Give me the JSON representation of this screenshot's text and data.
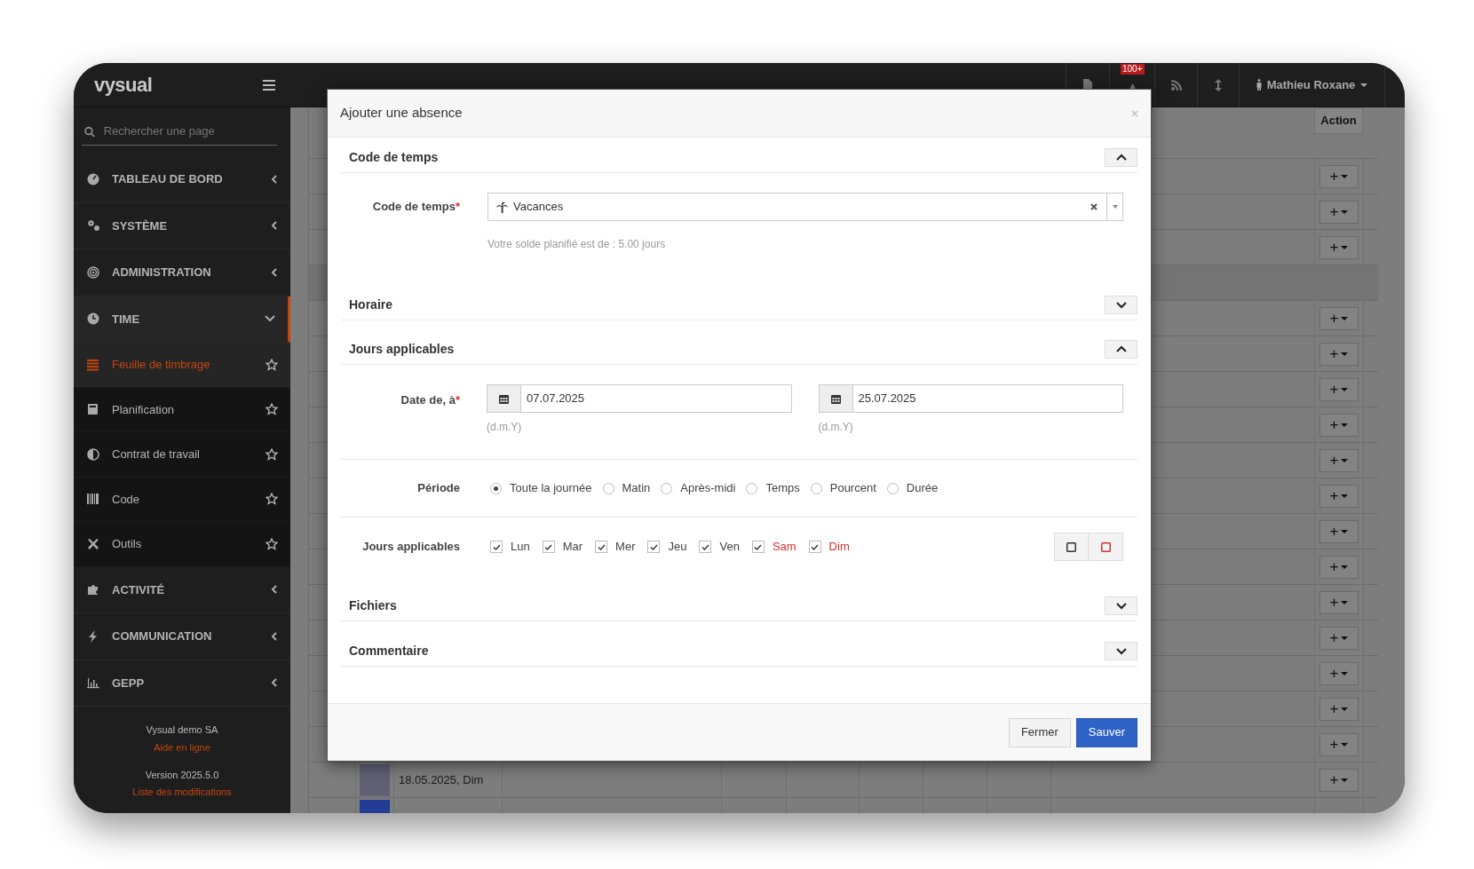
{
  "header": {
    "logo": "vysual",
    "notification_badge": "100+",
    "user": "Mathieu Roxane"
  },
  "sidebar": {
    "search_placeholder": "Rechercher une page",
    "items": [
      {
        "label": "TABLEAU DE BORD",
        "kind": "section",
        "expanded": false
      },
      {
        "label": "SYSTÈME",
        "kind": "section",
        "expanded": false
      },
      {
        "label": "ADMINISTRATION",
        "kind": "section",
        "expanded": false
      },
      {
        "label": "TIME",
        "kind": "section",
        "expanded": true
      },
      {
        "label": "Feuille de timbrage",
        "kind": "page",
        "selected": true
      },
      {
        "label": "Planification",
        "kind": "page",
        "selected": false
      },
      {
        "label": "Contrat de travail",
        "kind": "page",
        "selected": false
      },
      {
        "label": "Code",
        "kind": "page",
        "selected": false
      },
      {
        "label": "Outils",
        "kind": "page",
        "selected": false
      },
      {
        "label": "ACTIVITÉ",
        "kind": "section",
        "expanded": false
      },
      {
        "label": "COMMUNICATION",
        "kind": "section",
        "expanded": false
      },
      {
        "label": "GEPP",
        "kind": "section",
        "expanded": false
      }
    ],
    "footer": {
      "company": "Vysual demo SA",
      "help_link": "Aide en ligne",
      "version": "Version 2025.5.0",
      "changelog_link": "Liste des modifications"
    }
  },
  "table": {
    "action_header": "Action",
    "rows": [
      {
        "kind": "row",
        "action": "+"
      },
      {
        "kind": "row",
        "action": "+"
      },
      {
        "kind": "row",
        "action": "+"
      },
      {
        "kind": "group"
      },
      {
        "kind": "row",
        "action": "+"
      },
      {
        "kind": "row",
        "action": "+"
      },
      {
        "kind": "row",
        "action": "+"
      },
      {
        "kind": "row",
        "action": "+"
      },
      {
        "kind": "row",
        "action": "+"
      },
      {
        "kind": "row",
        "action": "+"
      },
      {
        "kind": "row",
        "action": "+"
      },
      {
        "kind": "row",
        "action": "+"
      },
      {
        "kind": "row",
        "action": "+"
      },
      {
        "kind": "row",
        "action": "+"
      },
      {
        "kind": "row",
        "action": "+"
      },
      {
        "kind": "row",
        "action": "+"
      },
      {
        "kind": "row",
        "action": "+"
      },
      {
        "kind": "row",
        "action": "+",
        "color": "#5f6074",
        "date": "18.05.2025, Dim"
      },
      {
        "kind": "row",
        "color": "#233c96"
      }
    ]
  },
  "modal": {
    "title": "Ajouter une absence",
    "time_code_section": {
      "title": "Code de temps",
      "expanded": true,
      "label": "Code de temps",
      "required_mark": "*",
      "value": "Vacances",
      "hint": "Votre solde planifié est de : 5.00 jours"
    },
    "schedule_section": {
      "title": "Horaire",
      "expanded": false
    },
    "days_section": {
      "title": "Jours applicables",
      "expanded": true,
      "date_label": "Date de, à",
      "required_mark": "*",
      "date_from": "07.07.2025",
      "date_to": "25.07.2025",
      "format_from": "(d.m.Y)",
      "format_to": "(d.m.Y)",
      "period_label": "Période",
      "periods": [
        {
          "label": "Toute la journée",
          "selected": true
        },
        {
          "label": "Matin",
          "selected": false
        },
        {
          "label": "Après-midi",
          "selected": false
        },
        {
          "label": "Temps",
          "selected": false
        },
        {
          "label": "Pourcent",
          "selected": false
        },
        {
          "label": "Durée",
          "selected": false
        }
      ],
      "days_label": "Jours applicables",
      "days": [
        {
          "label": "Lun",
          "checked": true,
          "weekend": false
        },
        {
          "label": "Mar",
          "checked": true,
          "weekend": false
        },
        {
          "label": "Mer",
          "checked": true,
          "weekend": false
        },
        {
          "label": "Jeu",
          "checked": true,
          "weekend": false
        },
        {
          "label": "Ven",
          "checked": true,
          "weekend": false
        },
        {
          "label": "Sam",
          "checked": true,
          "weekend": true
        },
        {
          "label": "Dim",
          "checked": true,
          "weekend": true
        }
      ]
    },
    "files_section": {
      "title": "Fichiers",
      "expanded": false
    },
    "comment_section": {
      "title": "Commentaire",
      "expanded": false
    },
    "buttons": [
      {
        "label": "Fermer",
        "kind": "secondary"
      },
      {
        "label": "Sauver",
        "kind": "primary"
      }
    ]
  }
}
